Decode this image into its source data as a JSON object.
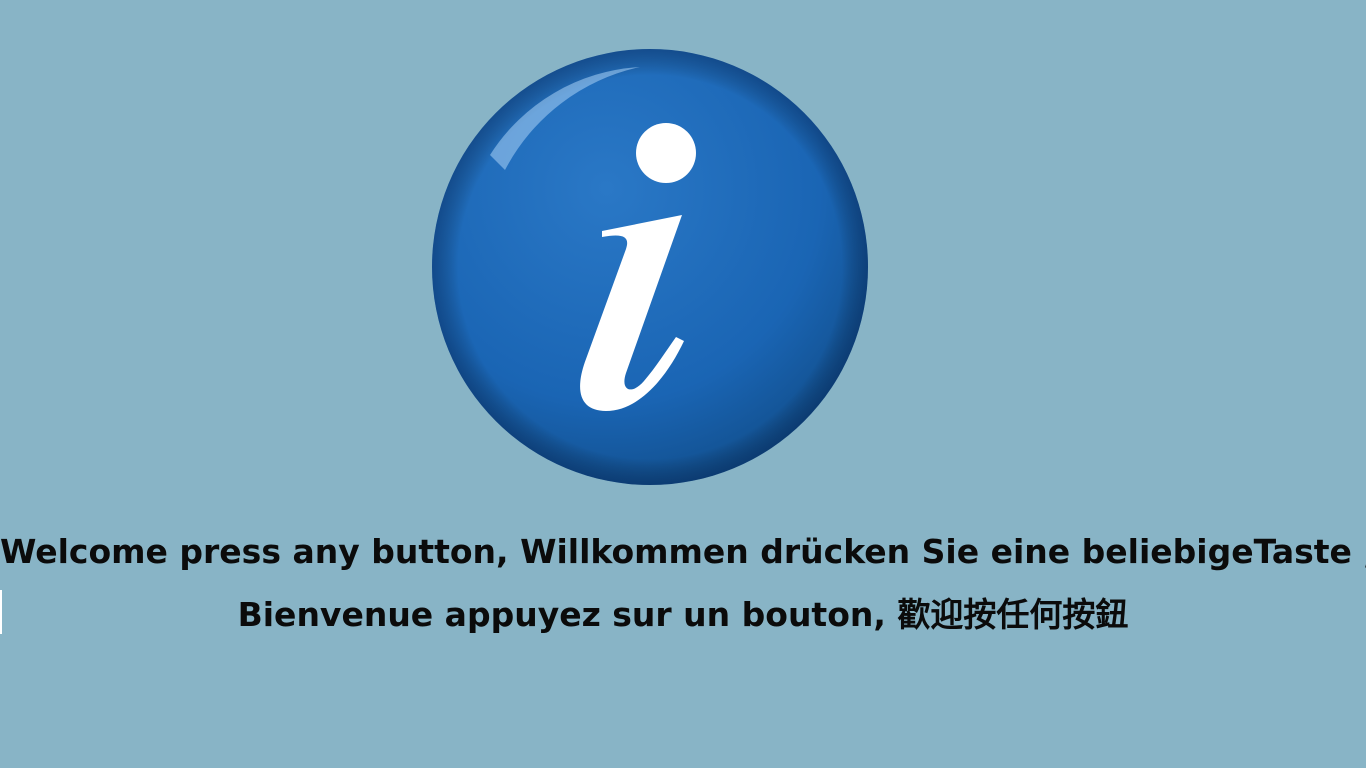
{
  "colors": {
    "background": "#88b4c6",
    "circle": "#1a65b4",
    "circle_highlight": "#4a97d8",
    "glyph": "#ffffff"
  },
  "icon": {
    "name": "info-icon"
  },
  "message": {
    "line1": "Welcome press any button, Willkommen drücken Sie eine beliebigeTaste ,",
    "line2": "Bienvenue appuyez sur un bouton, 歡迎按任何按鈕"
  }
}
